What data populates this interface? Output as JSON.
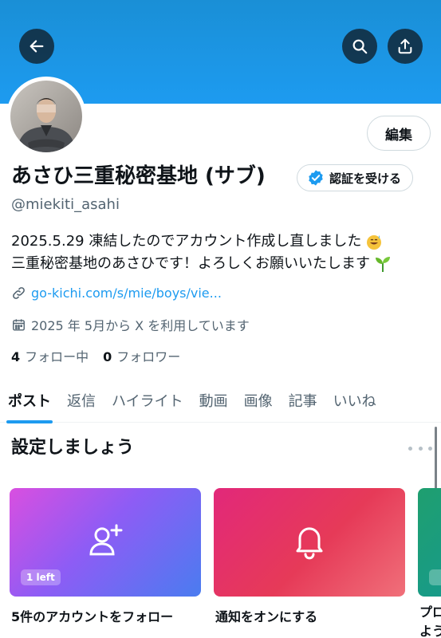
{
  "header": {
    "back_icon": "arrow-left-icon",
    "search_icon": "search-icon",
    "share_icon": "share-upload-icon",
    "banner_color": "#1d9bf0"
  },
  "profile": {
    "edit_label": "編集",
    "name": "あさひ三重秘密基地 (サブ)",
    "verify_label": "認証を受ける",
    "handle": "@miekiti_asahi",
    "bio_line1": "2025.5.29 凍結したのでアカウント作成し直しました",
    "bio_line2": "三重秘密基地のあさひです！よろしくお願いいたします",
    "link": "go-kichi.com/s/mie/boys/vie...",
    "joined": "2025 年 5月から X を利用しています",
    "following_count": "4",
    "following_label": "フォロー中",
    "followers_count": "0",
    "followers_label": "フォロワー"
  },
  "tabs": [
    {
      "label": "ポスト",
      "active": true
    },
    {
      "label": "返信",
      "active": false
    },
    {
      "label": "ハイライト",
      "active": false
    },
    {
      "label": "動画",
      "active": false
    },
    {
      "label": "画像",
      "active": false
    },
    {
      "label": "記事",
      "active": false
    },
    {
      "label": "いいね",
      "active": false
    }
  ],
  "setup": {
    "title": "設定しましょう",
    "cards": [
      {
        "label": "5件のアカウントをフォロー",
        "badge": "1 left",
        "icon": "add-user-icon"
      },
      {
        "label": "通知をオンにする",
        "icon": "bell-icon"
      },
      {
        "label": "プロ\nよう",
        "icon": "profile-icon"
      }
    ]
  }
}
